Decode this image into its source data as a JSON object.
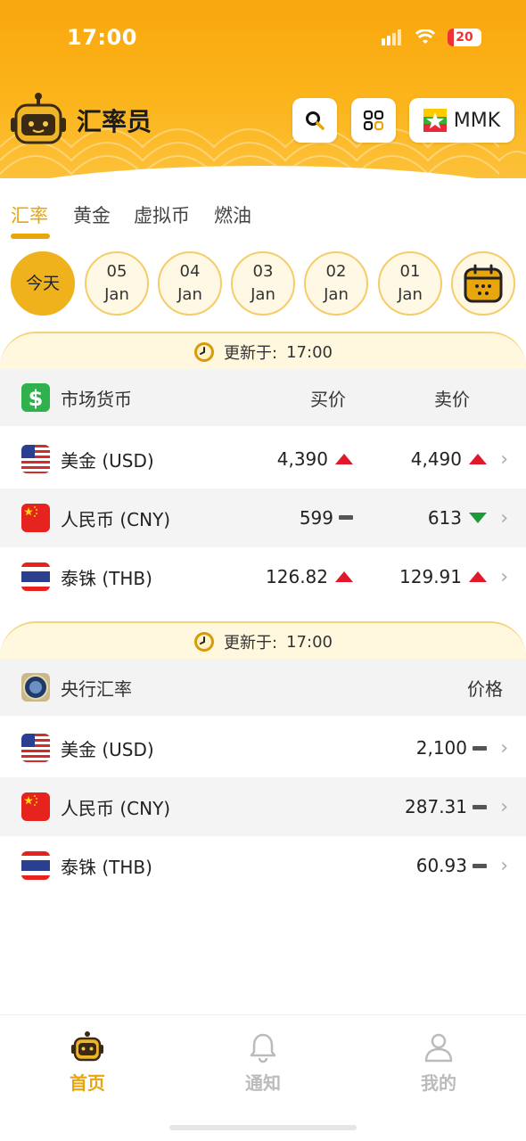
{
  "status": {
    "time": "17:00",
    "battery": "20"
  },
  "app": {
    "title": "汇率员"
  },
  "header": {
    "currency_label": "MMK"
  },
  "tabs": [
    {
      "label": "汇率"
    },
    {
      "label": "黄金"
    },
    {
      "label": "虚拟币"
    },
    {
      "label": "燃油"
    }
  ],
  "dates": [
    {
      "day": "今天",
      "month": ""
    },
    {
      "day": "05",
      "month": "Jan"
    },
    {
      "day": "04",
      "month": "Jan"
    },
    {
      "day": "03",
      "month": "Jan"
    },
    {
      "day": "02",
      "month": "Jan"
    },
    {
      "day": "01",
      "month": "Jan"
    }
  ],
  "market": {
    "updated_label": "更新于:",
    "updated_time": "17:00",
    "title": "市场货币",
    "buy_label": "买价",
    "sell_label": "卖价",
    "rows": [
      {
        "name": "美金 (USD)",
        "buy": "4,390",
        "buy_trend": "up",
        "sell": "4,490",
        "sell_trend": "up"
      },
      {
        "name": "人民币 (CNY)",
        "buy": "599",
        "buy_trend": "flat",
        "sell": "613",
        "sell_trend": "down"
      },
      {
        "name": "泰铢 (THB)",
        "buy": "126.82",
        "buy_trend": "up",
        "sell": "129.91",
        "sell_trend": "up"
      }
    ]
  },
  "central": {
    "updated_label": "更新于:",
    "updated_time": "17:00",
    "title": "央行汇率",
    "price_label": "价格",
    "rows": [
      {
        "name": "美金 (USD)",
        "price": "2,100",
        "trend": "flat"
      },
      {
        "name": "人民币 (CNY)",
        "price": "287.31",
        "trend": "flat"
      },
      {
        "name": "泰铢 (THB)",
        "price": "60.93",
        "trend": "flat"
      }
    ]
  },
  "nav": [
    {
      "label": "首页"
    },
    {
      "label": "通知"
    },
    {
      "label": "我的"
    }
  ],
  "colors": {
    "accent": "#e8a50c",
    "up": "#e0192a",
    "down": "#1f9a3b",
    "flat": "#555555"
  }
}
